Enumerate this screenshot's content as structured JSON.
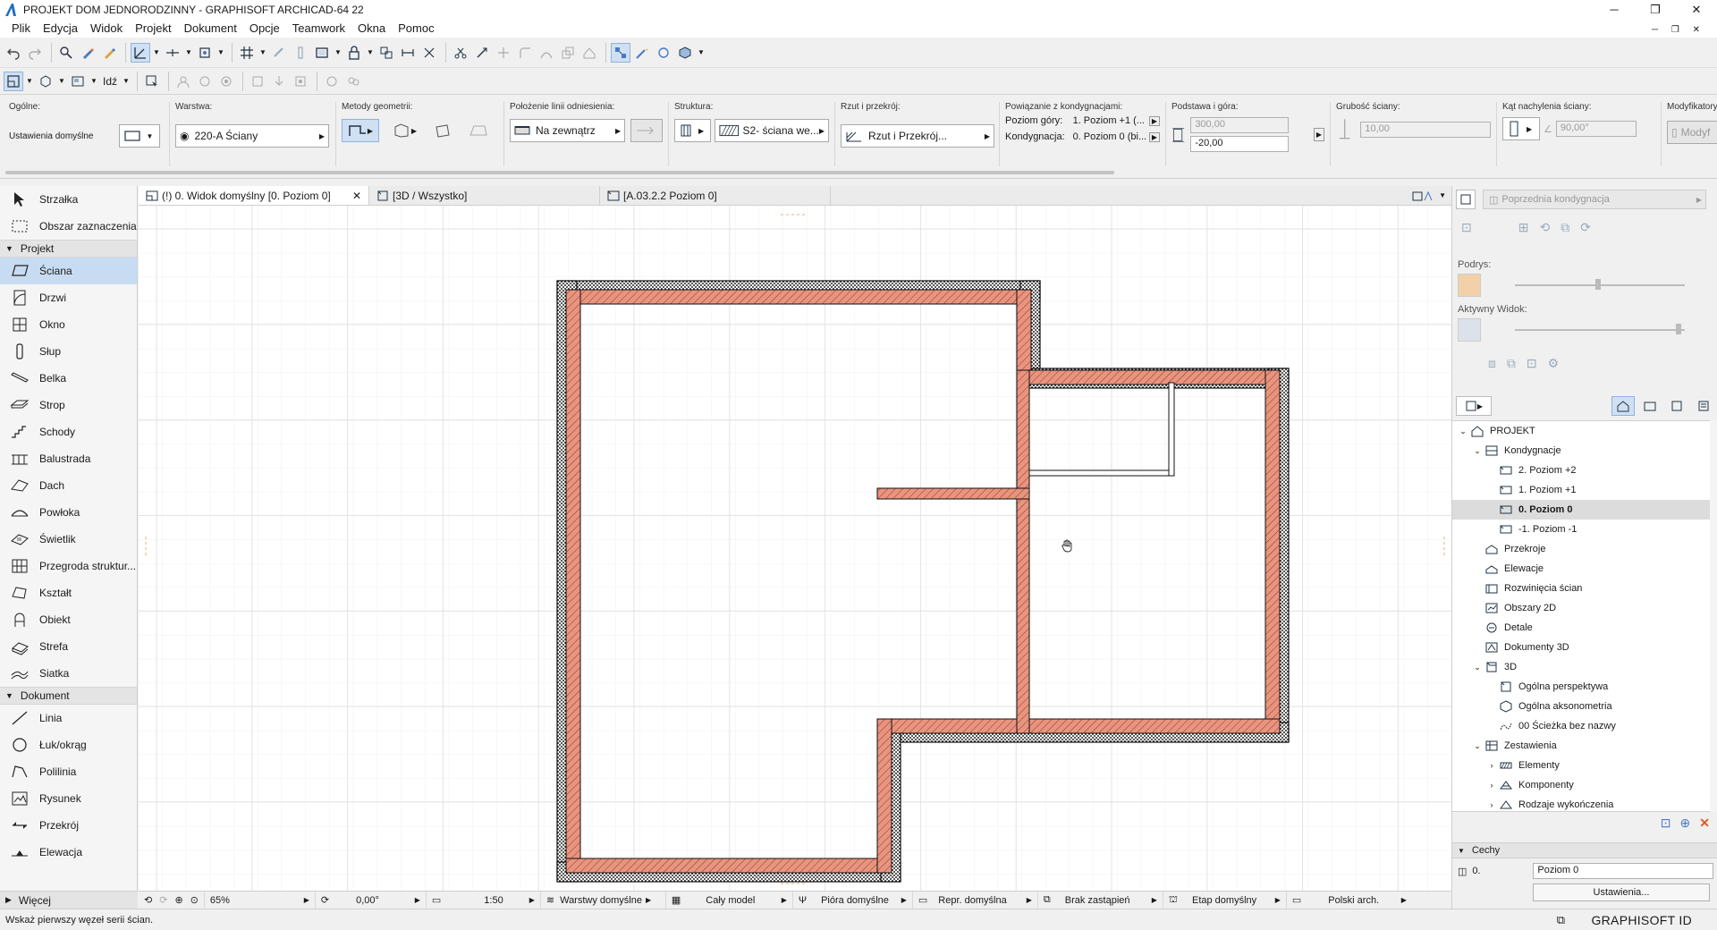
{
  "window": {
    "title": "PROJEKT DOM JEDNORODZINNY - GRAPHISOFT ARCHICAD-64 22",
    "controls": [
      "─",
      "❐",
      "✕"
    ]
  },
  "menu": [
    "Plik",
    "Edycja",
    "Widok",
    "Projekt",
    "Dokument",
    "Opcje",
    "Teamwork",
    "Okna",
    "Pomoc"
  ],
  "infobox": {
    "general_label": "Ogólne:",
    "general_value": "Ustawienia domyślne",
    "layer_label": "Warstwa:",
    "layer_value": "220-A Ściany",
    "geometry_label": "Metody geometrii:",
    "refline_label": "Położenie linii odniesienia:",
    "refline_value": "Na zewnątrz",
    "structure_label": "Struktura:",
    "structure_value": "S2- ściana we...",
    "plan_label": "Rzut i przekrój:",
    "plan_value": "Rzut i Przekrój...",
    "story_link_label": "Powiązanie z kondygnacjami:",
    "top_story_label": "Poziom góry:",
    "top_story_value": "1. Poziom +1 (...",
    "home_story_label": "Kondygnacja:",
    "home_story_value": "0. Poziom 0 (bi...",
    "base_top_label": "Podstawa i góra:",
    "top_value": "300,00",
    "base_value": "-20,00",
    "thickness_label": "Grubość ściany:",
    "thickness_value": "10,00",
    "slant_label": "Kąt nachylenia ściany:",
    "slant_value": "90,00°",
    "modifiers_label": "Modyfikatory pr",
    "modifiers_value": "Modyf"
  },
  "toolbox": {
    "top": [
      {
        "label": "Strzałka",
        "icon": "arrow-icon"
      },
      {
        "label": "Obszar zaznaczenia",
        "icon": "marquee-icon"
      }
    ],
    "project_header": "Projekt",
    "project": [
      {
        "label": "Ściana",
        "icon": "wall-icon",
        "selected": true
      },
      {
        "label": "Drzwi",
        "icon": "door-icon"
      },
      {
        "label": "Okno",
        "icon": "window-icon"
      },
      {
        "label": "Słup",
        "icon": "column-icon"
      },
      {
        "label": "Belka",
        "icon": "beam-icon"
      },
      {
        "label": "Strop",
        "icon": "slab-icon"
      },
      {
        "label": "Schody",
        "icon": "stair-icon"
      },
      {
        "label": "Balustrada",
        "icon": "railing-icon"
      },
      {
        "label": "Dach",
        "icon": "roof-icon"
      },
      {
        "label": "Powłoka",
        "icon": "shell-icon"
      },
      {
        "label": "Świetlik",
        "icon": "skylight-icon"
      },
      {
        "label": "Przegroda struktur...",
        "icon": "curtain-wall-icon"
      },
      {
        "label": "Kształt",
        "icon": "morph-icon"
      },
      {
        "label": "Obiekt",
        "icon": "object-icon"
      },
      {
        "label": "Strefa",
        "icon": "zone-icon"
      },
      {
        "label": "Siatka",
        "icon": "mesh-icon"
      }
    ],
    "document_header": "Dokument",
    "document": [
      {
        "label": "Linia",
        "icon": "line-icon"
      },
      {
        "label": "Łuk/okrąg",
        "icon": "arc-icon"
      },
      {
        "label": "Polilinia",
        "icon": "polyline-icon"
      },
      {
        "label": "Rysunek",
        "icon": "drawing-icon"
      },
      {
        "label": "Przekrój",
        "icon": "section-icon"
      },
      {
        "label": "Elewacja",
        "icon": "elevation-icon"
      }
    ],
    "more": "Więcej"
  },
  "tabs": [
    {
      "label": "(!) 0. Widok domyślny [0. Poziom 0]",
      "active": true
    },
    {
      "label": "[3D / Wszystko]",
      "active": false
    },
    {
      "label": "[A.03.2.2 Poziom 0]",
      "active": false
    }
  ],
  "right_panel": {
    "prev_story": "Poprzednia kondygnacja",
    "trace_label": "Podrys:",
    "active_view_label": "Aktywny Widok:",
    "tree": [
      {
        "label": "PROJEKT",
        "level": 0,
        "exp": "v",
        "icon": "project-icon"
      },
      {
        "label": "Kondygnacje",
        "level": 1,
        "exp": "v",
        "icon": "stories-icon"
      },
      {
        "label": "2. Poziom +2",
        "level": 2,
        "exp": "",
        "icon": "story-icon"
      },
      {
        "label": "1. Poziom +1",
        "level": 2,
        "exp": "",
        "icon": "story-icon"
      },
      {
        "label": "0. Poziom 0",
        "level": 2,
        "exp": "",
        "icon": "story-icon",
        "selected": true
      },
      {
        "label": "-1. Poziom -1",
        "level": 2,
        "exp": "",
        "icon": "story-icon"
      },
      {
        "label": "Przekroje",
        "level": 1,
        "exp": "",
        "icon": "sections-icon"
      },
      {
        "label": "Elewacje",
        "level": 1,
        "exp": "",
        "icon": "elevations-icon"
      },
      {
        "label": "Rozwinięcia ścian",
        "level": 1,
        "exp": "",
        "icon": "interior-elevations-icon"
      },
      {
        "label": "Obszary 2D",
        "level": 1,
        "exp": "",
        "icon": "worksheets-icon"
      },
      {
        "label": "Detale",
        "level": 1,
        "exp": "",
        "icon": "details-icon"
      },
      {
        "label": "Dokumenty 3D",
        "level": 1,
        "exp": "",
        "icon": "documents-3d-icon"
      },
      {
        "label": "3D",
        "level": 1,
        "exp": "v",
        "icon": "3d-icon"
      },
      {
        "label": "Ogólna perspektywa",
        "level": 2,
        "exp": "",
        "icon": "perspective-icon"
      },
      {
        "label": "Ogólna aksonometria",
        "level": 2,
        "exp": "",
        "icon": "axonometry-icon"
      },
      {
        "label": "00 Ścieżka bez nazwy",
        "level": 2,
        "exp": "",
        "icon": "path-icon"
      },
      {
        "label": "Zestawienia",
        "level": 1,
        "exp": "v",
        "icon": "schedules-icon"
      },
      {
        "label": "Elementy",
        "level": 2,
        "exp": ">",
        "icon": "elements-icon"
      },
      {
        "label": "Komponenty",
        "level": 2,
        "exp": ">",
        "icon": "components-icon"
      },
      {
        "label": "Rodzaje wykończenia",
        "level": 2,
        "exp": ">",
        "icon": "finishes-icon"
      }
    ],
    "props_header": "Cechy",
    "prop_id": "0.",
    "prop_value": "Poziom 0",
    "settings_button": "Ustawienia..."
  },
  "navbar": {
    "zoom": "65%",
    "angle": "0,00°",
    "scale": "1:50",
    "layers": "Warstwy domyślne",
    "model": "Cały model",
    "pens": "Pióra domyślne",
    "repr": "Repr. domyślna",
    "override": "Brak zastąpień",
    "phase": "Etap domyślny",
    "dimension": "Polski arch."
  },
  "status": {
    "message": "Wskaż pierwszy węzeł serii ścian.",
    "graphisoft_id": "GRAPHISOFT ID"
  },
  "colors": {
    "wall_fill": "#e8947f",
    "wall_outline": "#1a1a1a",
    "selection_blue": "#c7dcf3",
    "grid": "#e3e3e3"
  }
}
